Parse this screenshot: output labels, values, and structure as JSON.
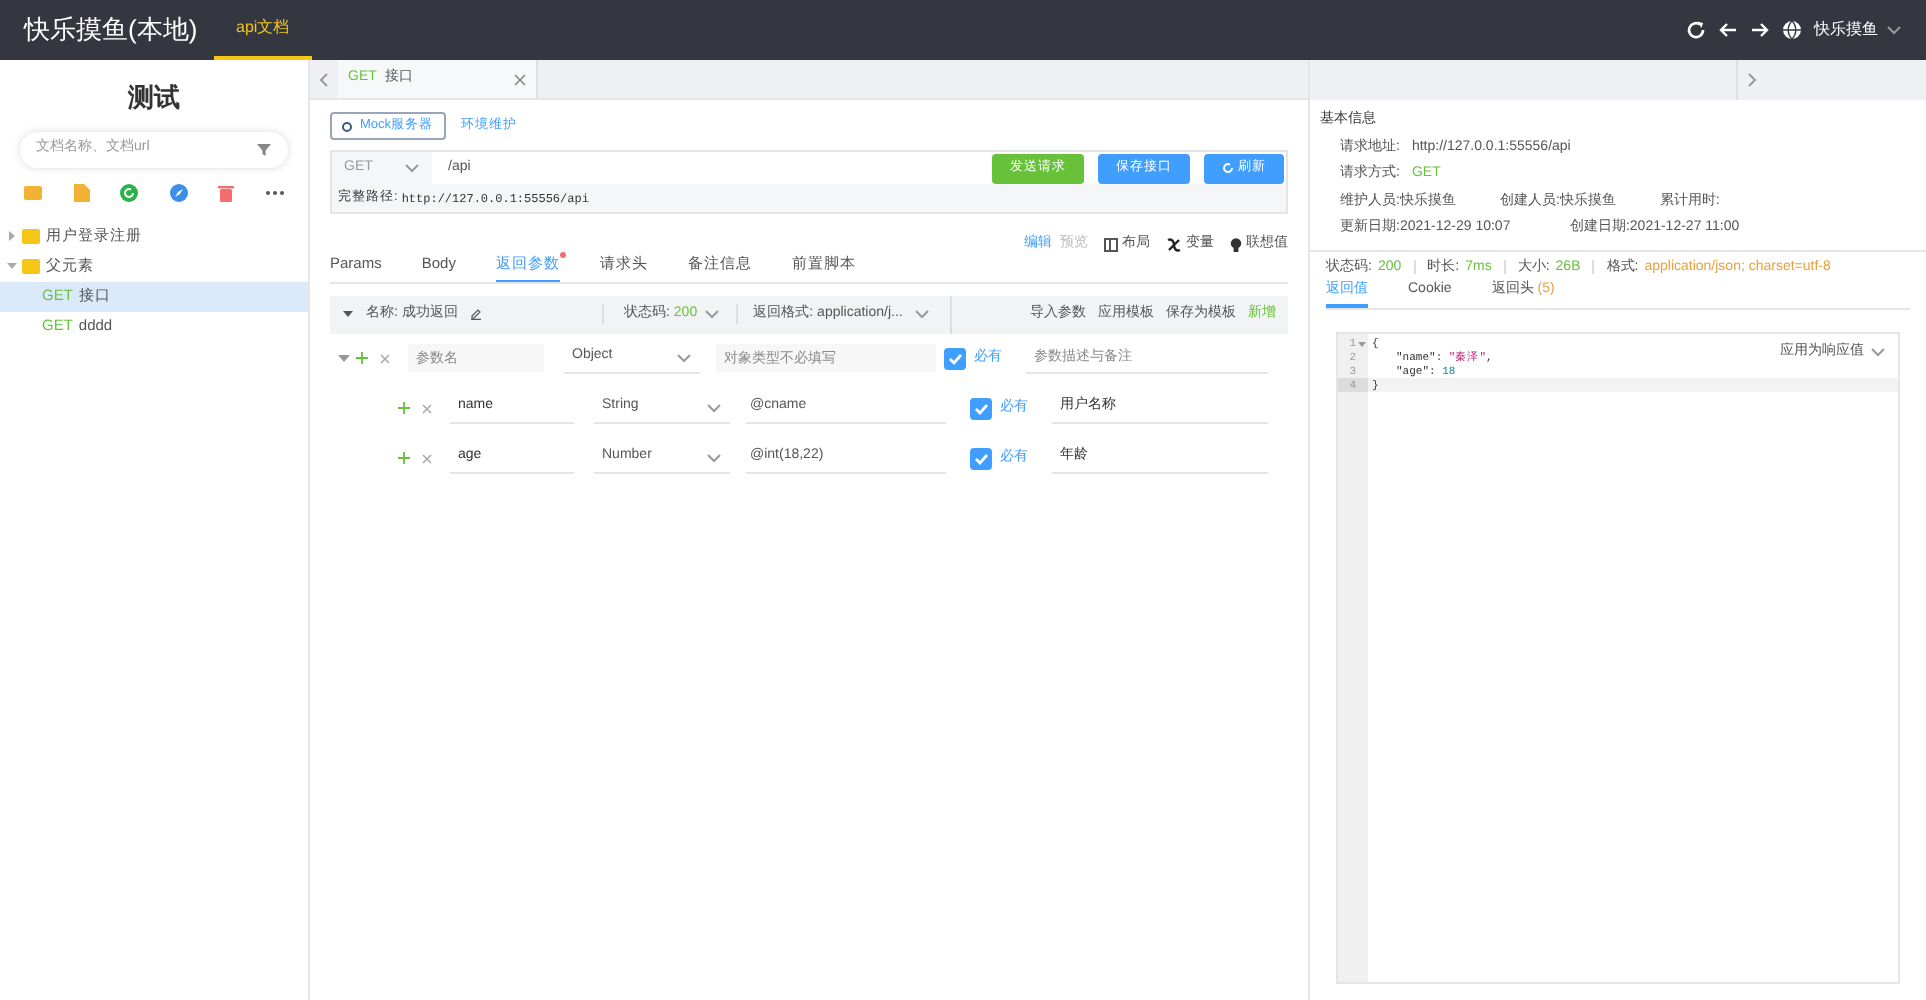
{
  "app": {
    "title": "快乐摸鱼(本地)",
    "nav_tabs": [
      {
        "label": "api文档",
        "selected": true
      }
    ],
    "user": "快乐摸鱼"
  },
  "sidebar": {
    "title": "测试",
    "search_placeholder": "文档名称、文档url",
    "tree": [
      {
        "label": "用户登录注册",
        "expanded": false
      },
      {
        "label": "父元素",
        "expanded": true,
        "children": [
          {
            "method": "GET",
            "label": "接口",
            "selected": true
          },
          {
            "method": "GET",
            "label": "dddd",
            "selected": false
          }
        ]
      }
    ]
  },
  "tabs": [
    {
      "method": "GET",
      "label": "接口",
      "selected": true
    }
  ],
  "toolbar": {
    "mock_button": "Mock服务器",
    "env_link": "环境维护"
  },
  "request": {
    "method": "GET",
    "url": "/api",
    "buttons": [
      {
        "label": "发送请求",
        "kind": "send"
      },
      {
        "label": "保存接口",
        "kind": "save"
      },
      {
        "label": "刷新",
        "kind": "refresh"
      }
    ],
    "full_path_label": "完整路径:",
    "full_path": "http://127.0.0.1:55556/api"
  },
  "editor_modes": [
    {
      "label": "编辑",
      "selected": true
    },
    {
      "label": "预览",
      "selected": false
    }
  ],
  "tools": [
    {
      "label": "布局",
      "kind": "layout"
    },
    {
      "label": "变量",
      "kind": "variable"
    },
    {
      "label": "联想值",
      "kind": "suggest"
    }
  ],
  "param_tabs": [
    {
      "label": "Params",
      "selected": false,
      "dot": false
    },
    {
      "label": "Body",
      "selected": false,
      "dot": false
    },
    {
      "label": "返回参数",
      "selected": true,
      "dot": true
    },
    {
      "label": "请求头",
      "selected": false,
      "dot": false
    },
    {
      "label": "备注信息",
      "selected": false,
      "dot": false
    },
    {
      "label": "前置脚本",
      "selected": false,
      "dot": false
    }
  ],
  "response_def": {
    "expanded": true,
    "name_label": "名称:",
    "name": "成功返回",
    "status_label": "状态码:",
    "status": "200",
    "format_label": "返回格式:",
    "format": "application/j...",
    "actions": [
      {
        "label": "导入参数",
        "kind": "plain"
      },
      {
        "label": "应用模板",
        "kind": "plain"
      },
      {
        "label": "保存为模板",
        "kind": "plain"
      },
      {
        "label": "新增",
        "kind": "add"
      }
    ]
  },
  "params": [
    {
      "expanded": true,
      "name_placeholder": "参数名",
      "type": "Object",
      "mock_placeholder": "对象类型不必填写",
      "required": true,
      "required_label": "必有",
      "desc_placeholder": "参数描述与备注",
      "children": [
        {
          "name": "name",
          "type": "String",
          "mock": "@cname",
          "required": true,
          "required_label": "必有",
          "desc": "用户名称"
        },
        {
          "name": "age",
          "type": "Number",
          "mock": "@int(18,22)",
          "required": true,
          "required_label": "必有",
          "desc": "年龄"
        }
      ]
    }
  ],
  "info": {
    "title": "基本信息",
    "url_label": "请求地址:",
    "url": "http://127.0.0.1:55556/api",
    "method_label": "请求方式:",
    "method": "GET",
    "maintainer_label": "维护人员:",
    "maintainer": "快乐摸鱼",
    "creator_label": "创建人员:",
    "creator": "快乐摸鱼",
    "time_label": "累计用时:",
    "updated_label": "更新日期:",
    "updated": "2021-12-29 10:07",
    "created_label": "创建日期:",
    "created": "2021-12-27 11:00"
  },
  "result": {
    "status_label": "状态码:",
    "status": "200",
    "duration_label": "时长:",
    "duration": "7ms",
    "size_label": "大小:",
    "size": "26B",
    "format_label": "格式:",
    "format": "application/json; charset=utf-8"
  },
  "result_tabs": [
    {
      "label": "返回值",
      "selected": true
    },
    {
      "label": "Cookie",
      "selected": false
    },
    {
      "label": "返回头",
      "selected": false,
      "count": "(5)"
    }
  ],
  "code": {
    "apply_button": "应用为响应值",
    "lines": [
      {
        "num": "1",
        "fold": true,
        "active": false,
        "parts": [
          {
            "kind": "punct",
            "text": "{"
          }
        ]
      },
      {
        "num": "2",
        "active": false,
        "parts": [
          {
            "kind": "key",
            "text": "\"name\""
          },
          {
            "kind": "punct",
            "text": ": "
          },
          {
            "kind": "string",
            "text": "\"秦泽\""
          },
          {
            "kind": "punct",
            "text": ","
          }
        ]
      },
      {
        "num": "3",
        "active": false,
        "parts": [
          {
            "kind": "key",
            "text": "\"age\""
          },
          {
            "kind": "punct",
            "text": ": "
          },
          {
            "kind": "number",
            "text": "18"
          }
        ]
      },
      {
        "num": "4",
        "active": true,
        "parts": [
          {
            "kind": "punct",
            "text": "}"
          }
        ]
      }
    ]
  }
}
